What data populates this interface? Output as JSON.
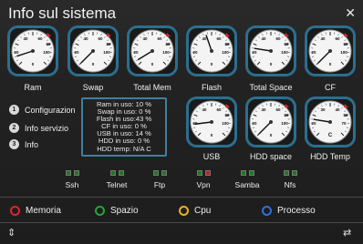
{
  "window": {
    "title": "Info sul sistema",
    "close_icon": "close-icon"
  },
  "gauges": [
    {
      "label": "Ram",
      "ticks": [
        "40",
        "60",
        "80",
        "20",
        "100",
        "0"
      ],
      "value": 10
    },
    {
      "label": "Swap",
      "ticks": [
        "40",
        "60",
        "80",
        "20",
        "100",
        "0"
      ],
      "value": 0
    },
    {
      "label": "Total Mem",
      "ticks": [
        "40",
        "60",
        "80",
        "20",
        "100",
        "0"
      ],
      "value": 5
    },
    {
      "label": "Flash",
      "ticks": [
        "40",
        "60",
        "80",
        "20",
        "100",
        "0"
      ],
      "value": 43
    },
    {
      "label": "Total Space",
      "ticks": [
        "40",
        "60",
        "80",
        "20",
        "100",
        "0"
      ],
      "value": 20
    },
    {
      "label": "CF",
      "ticks": [
        "40",
        "60",
        "80",
        "20",
        "100",
        "0"
      ],
      "value": 0
    },
    {
      "label": "USB",
      "ticks": [
        "40",
        "60",
        "80",
        "20",
        "100",
        "0"
      ],
      "value": 14
    },
    {
      "label": "HDD space",
      "ticks": [
        "40",
        "60",
        "80",
        "20",
        "100",
        "0"
      ],
      "value": 0
    },
    {
      "label": "HDD Temp",
      "ticks": [
        "30",
        "40",
        "50",
        "20",
        "70",
        "C"
      ],
      "value": 20
    }
  ],
  "menu": [
    {
      "num": "1",
      "label": "Configurazion"
    },
    {
      "num": "2",
      "label": "Info servizio"
    },
    {
      "num": "3",
      "label": "Info"
    }
  ],
  "info": [
    "Ram in uso: 10 %",
    "Swap in uso: 0 %",
    "Flash in uso:43 %",
    "CF in uso: 0 %",
    "USB in uso: 14 %",
    "HDD in uso: 0 %",
    "HDD temp: N/A C"
  ],
  "services": [
    {
      "label": "Ssh",
      "leds": [
        "green",
        "green"
      ]
    },
    {
      "label": "Telnet",
      "leds": [
        "green",
        "green"
      ]
    },
    {
      "label": "Ftp",
      "leds": [
        "green",
        "green"
      ]
    },
    {
      "label": "Vpn",
      "leds": [
        "green",
        "red"
      ]
    },
    {
      "label": "Samba",
      "leds": [
        "green",
        "green"
      ]
    },
    {
      "label": "Nfs",
      "leds": [
        "green",
        "green"
      ]
    }
  ],
  "legend": [
    {
      "label": "Memoria",
      "color": "#e0242c"
    },
    {
      "label": "Spazio",
      "color": "#21a83a"
    },
    {
      "label": "Cpu",
      "color": "#e9b41c"
    },
    {
      "label": "Processo",
      "color": "#2d6fe0"
    }
  ],
  "footer": {
    "left_icon": "up-down-arrows-icon",
    "right_icon": "swap-arrows-icon"
  },
  "colors": {
    "gauge_ring": "#2b6f8f",
    "accent_red": "#e0242c"
  }
}
